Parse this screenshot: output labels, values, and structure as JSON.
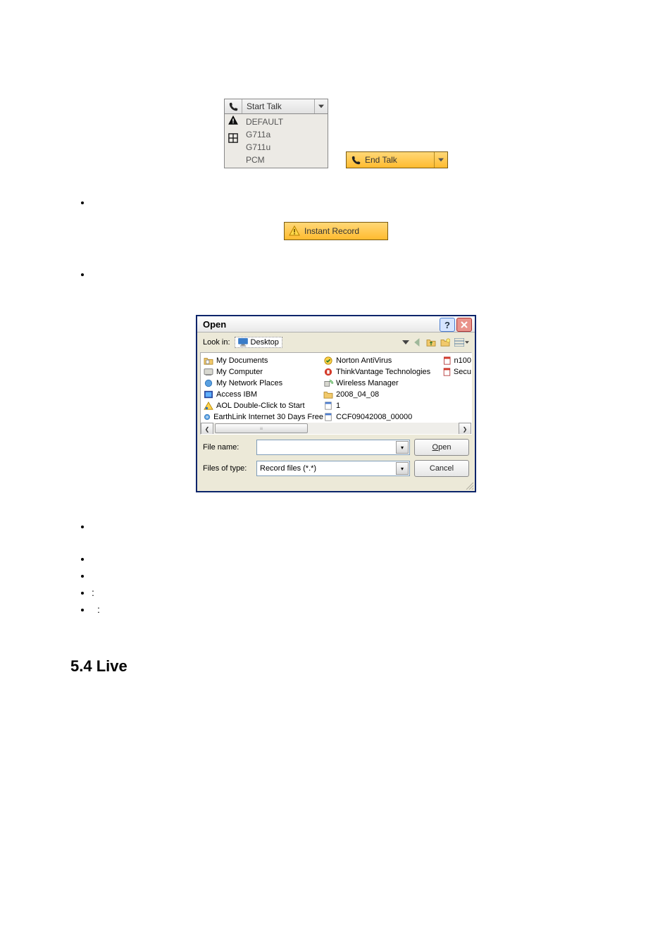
{
  "starttalk": {
    "label": "Start Talk",
    "options": [
      "DEFAULT",
      "G711a",
      "G711u",
      "PCM"
    ]
  },
  "endtalk": {
    "label": "End Talk"
  },
  "instantrec": {
    "label": "Instant Record"
  },
  "opendlg": {
    "title": "Open",
    "lookin_label": "Look in:",
    "lookin_value": "Desktop",
    "files_col1": [
      "My Documents",
      "My Computer",
      "My Network Places",
      "Access IBM",
      "AOL Double-Click to Start",
      "EarthLink Internet 30 Days Free"
    ],
    "files_col2": [
      "Norton AntiVirus",
      "ThinkVantage Technologies",
      "Wireless Manager",
      "2008_04_08",
      "1",
      "CCF09042008_00000"
    ],
    "files_col3": [
      "n100",
      "Secu"
    ],
    "filename_label": "File name:",
    "filename_value": "",
    "filetype_label": "Files of type:",
    "filetype_value": "Record files (*.*)",
    "open_btn": "Open",
    "cancel_btn": "Cancel"
  },
  "bullets_row4": ":",
  "bullets_row5": ":",
  "heading": "5.4  Live"
}
